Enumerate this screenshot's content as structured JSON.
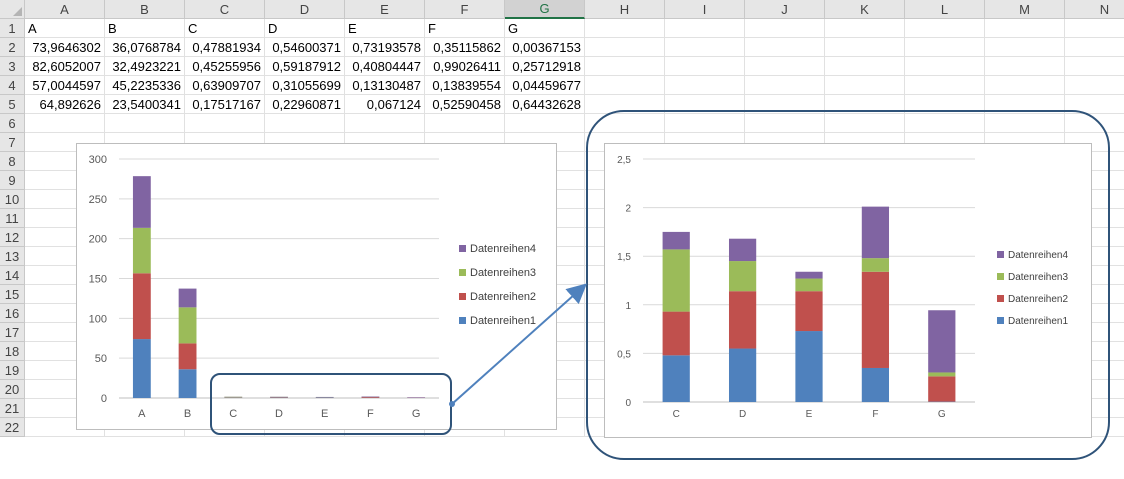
{
  "sheet": {
    "columns": [
      "A",
      "B",
      "C",
      "D",
      "E",
      "F",
      "G",
      "H",
      "I",
      "J",
      "K",
      "L",
      "M",
      "N"
    ],
    "rows": [
      "1",
      "2",
      "3",
      "4",
      "5",
      "6",
      "7",
      "8",
      "9",
      "10",
      "11",
      "12",
      "13",
      "14",
      "15",
      "16",
      "17",
      "18",
      "19",
      "20",
      "21",
      "22"
    ],
    "selected_column": "G",
    "header_row": [
      "A",
      "B",
      "C",
      "D",
      "E",
      "F",
      "G"
    ],
    "data_rows": [
      [
        "73,9646302",
        "36,0768784",
        "0,47881934",
        "0,54600371",
        "0,73193578",
        "0,35115862",
        "0,00367153"
      ],
      [
        "82,6052007",
        "32,4923221",
        "0,45255956",
        "0,59187912",
        "0,40804447",
        "0,99026411",
        "0,25712918"
      ],
      [
        "57,0044597",
        "45,2235336",
        "0,63909707",
        "0,31055699",
        "0,13130487",
        "0,13839554",
        "0,04459677"
      ],
      [
        "64,892626",
        "23,5400341",
        "0,17517167",
        "0,22960871",
        "0,067124",
        "0,52590458",
        "0,64432628"
      ]
    ]
  },
  "colors": {
    "series1": "#4f81bd",
    "series2": "#c0504d",
    "series3": "#9bbb59",
    "series4": "#8064a2",
    "callout": "#2f5379",
    "arrow": "#4f81bd"
  },
  "chart_data": [
    {
      "type": "bar",
      "stacked": true,
      "categories": [
        "A",
        "B",
        "C",
        "D",
        "E",
        "F",
        "G"
      ],
      "series": [
        {
          "name": "Datenreihen1",
          "values": [
            73.96,
            36.08,
            0.48,
            0.55,
            0.73,
            0.35,
            0.004
          ]
        },
        {
          "name": "Datenreihen2",
          "values": [
            82.61,
            32.49,
            0.45,
            0.59,
            0.41,
            0.99,
            0.26
          ]
        },
        {
          "name": "Datenreihen3",
          "values": [
            57.0,
            45.22,
            0.64,
            0.31,
            0.13,
            0.14,
            0.04
          ]
        },
        {
          "name": "Datenreihen4",
          "values": [
            64.89,
            23.54,
            0.18,
            0.23,
            0.07,
            0.53,
            0.64
          ]
        }
      ],
      "yticks": [
        "0",
        "50",
        "100",
        "150",
        "200",
        "250",
        "300"
      ],
      "ylim": [
        0,
        300
      ],
      "grid": true,
      "legend": "right"
    },
    {
      "type": "bar",
      "stacked": true,
      "categories": [
        "C",
        "D",
        "E",
        "F",
        "G"
      ],
      "series": [
        {
          "name": "Datenreihen1",
          "values": [
            0.48,
            0.55,
            0.73,
            0.35,
            0.004
          ]
        },
        {
          "name": "Datenreihen2",
          "values": [
            0.45,
            0.59,
            0.41,
            0.99,
            0.26
          ]
        },
        {
          "name": "Datenreihen3",
          "values": [
            0.64,
            0.31,
            0.13,
            0.14,
            0.04
          ]
        },
        {
          "name": "Datenreihen4",
          "values": [
            0.18,
            0.23,
            0.07,
            0.53,
            0.64
          ]
        }
      ],
      "yticks": [
        "0",
        "0,5",
        "1",
        "1,5",
        "2",
        "2,5"
      ],
      "ylim": [
        0,
        2.5
      ],
      "grid": true,
      "legend": "right"
    }
  ]
}
